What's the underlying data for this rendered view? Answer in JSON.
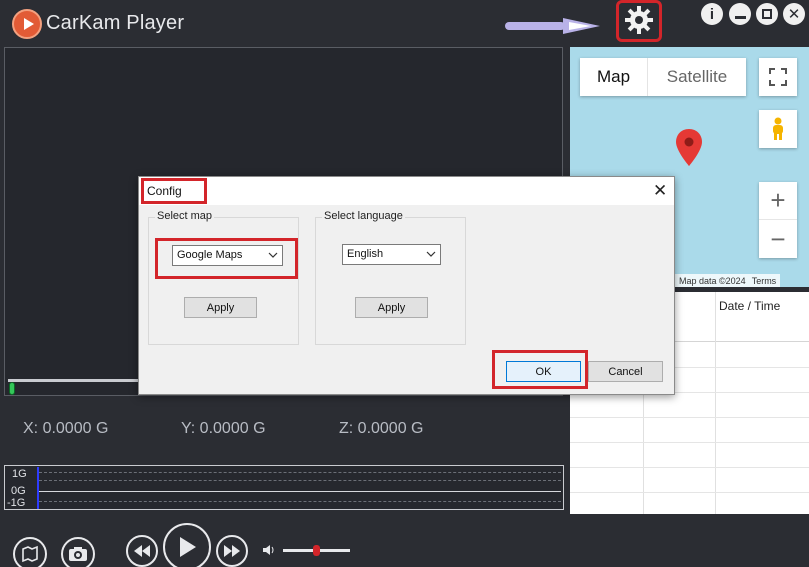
{
  "app": {
    "title": "CarKam Player",
    "accent_color": "#d3252a",
    "icons": [
      "logo-icon",
      "settings-gear-icon",
      "info-icon",
      "minimize-icon",
      "maximize-icon",
      "close-icon"
    ]
  },
  "gsensor": {
    "x_label": "X: 0.0000 G",
    "y_label": "Y: 0.0000 G",
    "z_label": "Z: 0.0000 G"
  },
  "graph": {
    "labels": [
      "1G",
      "0G",
      "-1G"
    ]
  },
  "controls": {
    "icons": [
      "map-export-icon",
      "snapshot-icon",
      "rewind-icon",
      "play-icon",
      "fast-forward-icon",
      "volume-icon"
    ],
    "volume_level": 0.5
  },
  "map": {
    "tabs": [
      "Map",
      "Satellite"
    ],
    "footer_data": "Map data ©2024",
    "footer_terms": "Terms"
  },
  "table": {
    "headers": [
      "",
      "Date / Time"
    ]
  },
  "dialog": {
    "title": "Config",
    "map_group_label": "Select map",
    "map_value": "Google Maps",
    "map_apply": "Apply",
    "lang_group_label": "Select language",
    "lang_value": "English",
    "lang_apply": "Apply",
    "ok_label": "OK",
    "cancel_label": "Cancel"
  }
}
